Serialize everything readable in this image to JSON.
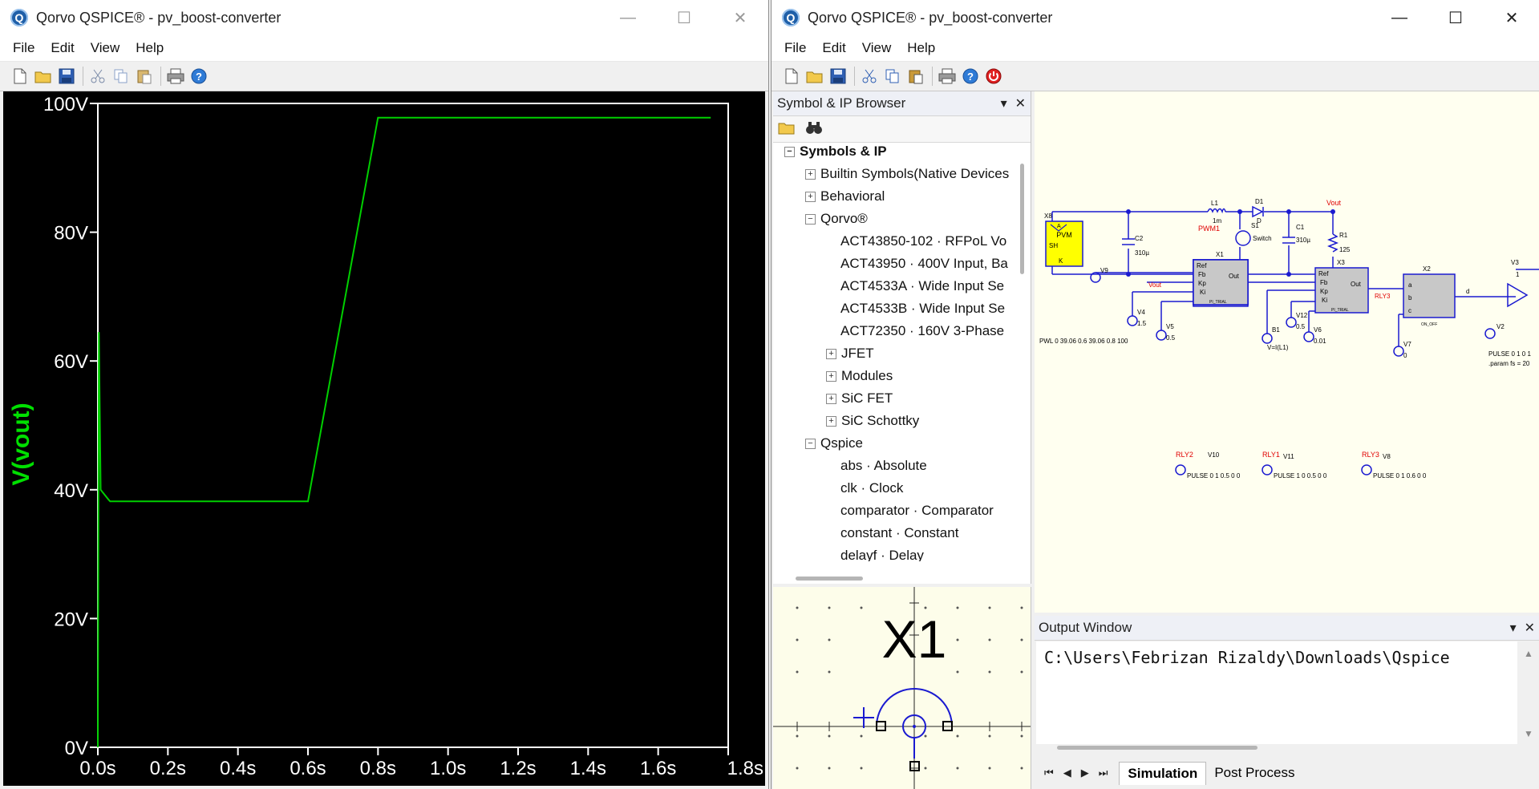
{
  "windows": {
    "left": {
      "title": "Qorvo QSPICE® - pv_boost-converter",
      "menu": [
        "File",
        "Edit",
        "View",
        "Help"
      ],
      "window_controls": {
        "minimize": "—",
        "maximize": "☐",
        "close": "✕"
      }
    },
    "right": {
      "title": "Qorvo QSPICE® - pv_boost-converter",
      "menu": [
        "File",
        "Edit",
        "View",
        "Help"
      ],
      "window_controls": {
        "minimize": "—",
        "maximize": "☐",
        "close": "✕"
      }
    }
  },
  "app_icon_letter": "Q",
  "toolbar_icons": [
    "new-file-icon",
    "open-folder-icon",
    "save-icon",
    "cut-icon",
    "copy-icon",
    "paste-icon",
    "print-icon",
    "help-icon",
    "halt-icon"
  ],
  "chart_data": {
    "type": "line",
    "ylabel": "V(vout)",
    "ylabel_color": "#00e000",
    "series_color": "#00d000",
    "xlim": [
      0,
      1.8
    ],
    "ylim": [
      0,
      100
    ],
    "x_ticks": [
      "0.0s",
      "0.2s",
      "0.4s",
      "0.6s",
      "0.8s",
      "1.0s",
      "1.2s",
      "1.4s",
      "1.6s",
      "1.8s"
    ],
    "y_ticks": [
      "0V",
      "20V",
      "40V",
      "60V",
      "80V",
      "100V"
    ],
    "series": [
      {
        "x": [
          0,
          0.003,
          0.008,
          0.03,
          0.035,
          0.04,
          0.6,
          0.8,
          1.75
        ],
        "values": [
          0,
          64.5,
          40,
          38.5,
          38.2,
          38.2,
          38.2,
          97.8,
          97.8
        ]
      }
    ]
  },
  "symbol_browser": {
    "title": "Symbol & IP Browser",
    "tree": [
      {
        "label": "Symbols & IP",
        "level": 0,
        "toggle": "⊟",
        "bold": true
      },
      {
        "label": "Builtin Symbols(Native Devices",
        "level": 1,
        "toggle": "⊞"
      },
      {
        "label": "Behavioral",
        "level": 1,
        "toggle": "⊞"
      },
      {
        "label": "Qorvo®",
        "level": 1,
        "toggle": "⊟"
      },
      {
        "label": "ACT43850-102 · RFPoL Vo",
        "level": 2,
        "toggle": ""
      },
      {
        "label": "ACT43950 · 400V Input, Ba",
        "level": 2,
        "toggle": ""
      },
      {
        "label": "ACT4533A · Wide Input Se",
        "level": 2,
        "toggle": ""
      },
      {
        "label": "ACT4533B · Wide Input Se",
        "level": 2,
        "toggle": ""
      },
      {
        "label": "ACT72350 · 160V 3-Phase",
        "level": 2,
        "toggle": ""
      },
      {
        "label": "JFET",
        "level": 2,
        "toggle": "⊞"
      },
      {
        "label": "Modules",
        "level": 2,
        "toggle": "⊞"
      },
      {
        "label": "SiC FET",
        "level": 2,
        "toggle": "⊞"
      },
      {
        "label": "SiC Schottky",
        "level": 2,
        "toggle": "⊞"
      },
      {
        "label": "Qspice",
        "level": 1,
        "toggle": "⊟"
      },
      {
        "label": "abs · Absolute",
        "level": 2,
        "toggle": ""
      },
      {
        "label": "clk · Clock",
        "level": 2,
        "toggle": ""
      },
      {
        "label": "comparator · Comparator",
        "level": 2,
        "toggle": ""
      },
      {
        "label": "constant · Constant",
        "level": 2,
        "toggle": ""
      },
      {
        "label": "delayf · Delay",
        "level": 2,
        "toggle": ""
      }
    ],
    "preview_label": "X1"
  },
  "schematic": {
    "pvm_label": "PVM",
    "pins": {
      "a": "A",
      "sh": "SH",
      "k": "K",
      "x": "X8"
    },
    "L1": "L1",
    "L1_val": "1m",
    "D1": "D1",
    "D1_val": "D",
    "C1": "C1",
    "C1_val": "310µ",
    "C2": "C2",
    "C2_val": "310µ",
    "R1": "R1",
    "R1_val": "125",
    "S1": "S1",
    "S1_val": "Switch",
    "pwm1": "PWM1",
    "vout": "Vout",
    "pwl": "PWL 0 39.06 0.6 39.06 0.8 100",
    "X1": "X1",
    "X3": "X3",
    "X2": "X2",
    "pi_pins": [
      "Ref",
      "Fb",
      "Kp",
      "Ki"
    ],
    "out": "Out",
    "pi_trial": "PI_TRIAL",
    "on_off": "ON_OFF",
    "x2_pins": [
      "a",
      "b",
      "c"
    ],
    "d": "d",
    "V9": "V9",
    "vout_net": "Vout",
    "V4": "V4",
    "V4_val": "1.5",
    "V5": "V5",
    "V5_val": "0.5",
    "B1": "B1",
    "B1_val": "V=I(L1)",
    "V12": "V12",
    "V12_val": "0.5",
    "V6": "V6",
    "V6_val": "0.01",
    "V7": "V7",
    "V7_val": "0",
    "V2": "V2",
    "V3": "V3",
    "V3_val": "1",
    "rly3_net": "RLY3",
    "rly2": "RLY2",
    "V10": "V10",
    "V10_val": "PULSE 0 1 0.5 0 0",
    "rly1": "RLY1",
    "V11": "V11",
    "V11_val": "PULSE 1 0 0.5 0 0",
    "rly3": "RLY3",
    "V8": "V8",
    "V8_val": "PULSE 0 1 0.6 0 0",
    "pulse_right": "PULSE 0 1 0 1",
    "param": ".param fs = 20"
  },
  "output_window": {
    "title": "Output Window",
    "text": "C:\\Users\\Febrizan Rizaldy\\Downloads\\Qspice",
    "tabs": [
      "Simulation",
      "Post Process"
    ],
    "nav": [
      "⏮",
      "◀",
      "▶",
      "⏭"
    ]
  }
}
